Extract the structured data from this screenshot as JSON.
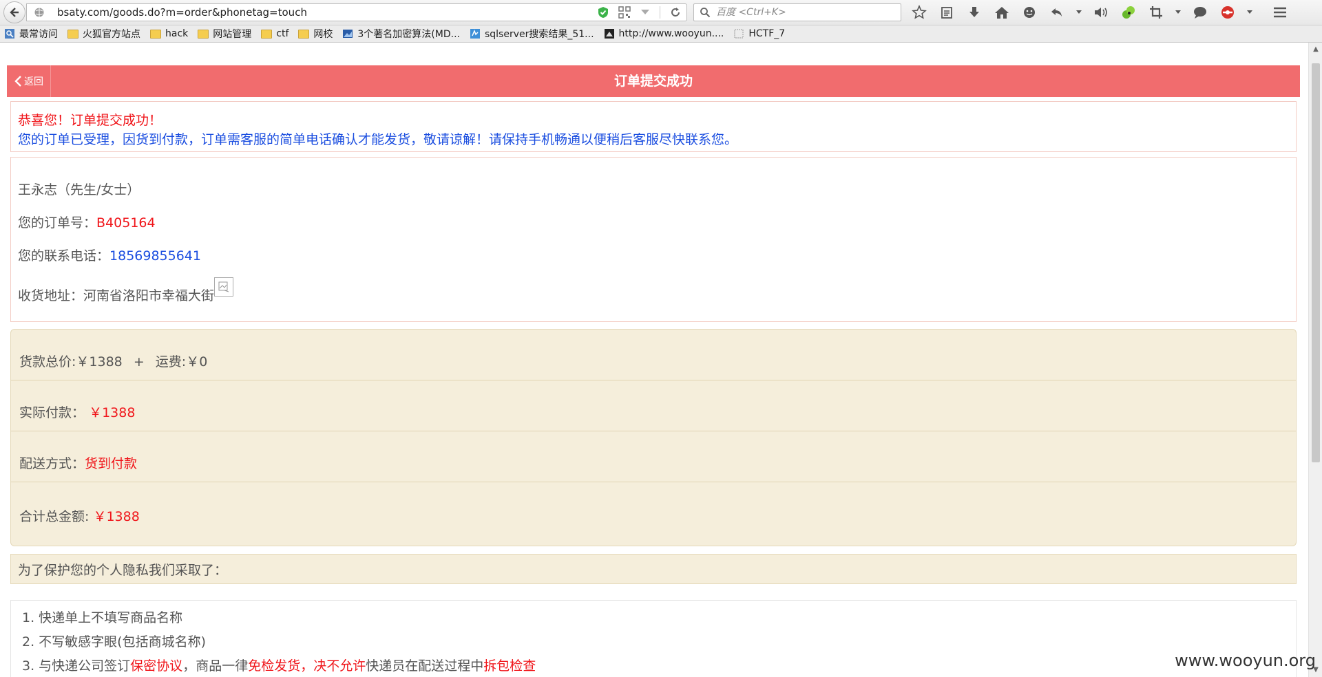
{
  "browser": {
    "url": "bsaty.com/goods.do?m=order&phonetag=touch",
    "search_placeholder": "百度 <Ctrl+K>"
  },
  "bookmarks": [
    {
      "label": "最常访问",
      "type": "special"
    },
    {
      "label": "火狐官方站点",
      "type": "folder"
    },
    {
      "label": "hack",
      "type": "folder"
    },
    {
      "label": "网站管理",
      "type": "folder"
    },
    {
      "label": "ctf",
      "type": "folder"
    },
    {
      "label": "网校",
      "type": "folder"
    },
    {
      "label": "3个著名加密算法(MD...",
      "type": "page"
    },
    {
      "label": "sqlserver搜索结果_51...",
      "type": "page"
    },
    {
      "label": "http://www.wooyun....",
      "type": "page"
    },
    {
      "label": "HCTF_7",
      "type": "page"
    }
  ],
  "header": {
    "back_label": "返回",
    "title": "订单提交成功"
  },
  "success": {
    "line1": "恭喜您！订单提交成功！",
    "line2": "您的订单已受理，因货到付款，订单需客服的简单电话确认才能发货，敬请谅解！请保持手机畅通以便稍后客服尽快联系您。"
  },
  "info": {
    "name": "王永志（先生/女士）",
    "order_label": "您的订单号：",
    "order_no": "B405164",
    "phone_label": "您的联系电话：",
    "phone": "18569855641",
    "address_label": "收货地址：",
    "address": "河南省洛阳市幸福大街"
  },
  "price": {
    "goods_label": "货款总价:",
    "goods_value": "￥1388",
    "plus": "+",
    "shipping_label": "运费:",
    "shipping_value": "￥0",
    "paid_label": "实际付款：",
    "paid_value": "￥1388",
    "delivery_label": "配送方式：",
    "delivery_value": "货到付款",
    "total_label": "合计总金额:",
    "total_value": "￥1388"
  },
  "privacy": {
    "heading": "为了保护您的个人隐私我们采取了：",
    "item1": "1. 快递单上不填写商品名称",
    "item2": "2. 不写敏感字眼(包括商城名称)",
    "item3_a": "3. 与快递公司签订",
    "item3_b": "保密协议",
    "item3_c": "，商品一律",
    "item3_d": "免检发货",
    "item3_e": "，",
    "item3_f": "决不允许",
    "item3_g": "快递员在配送过程中",
    "item3_h": "拆包检查"
  },
  "watermark": "www.wooyun.org",
  "colors": {
    "header_bg": "#f16c6e",
    "red_text": "#f0161b",
    "blue_text": "#1b4ee0",
    "price_bg": "#f5eedb"
  }
}
